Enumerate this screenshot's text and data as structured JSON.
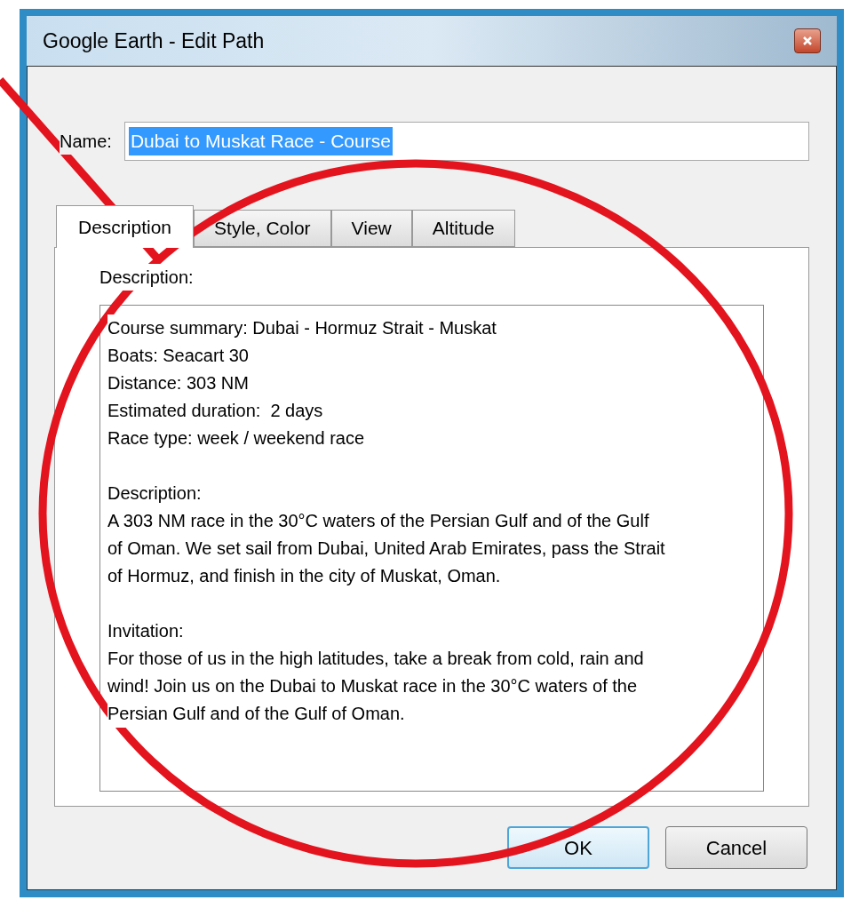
{
  "window": {
    "title": "Google Earth - Edit Path"
  },
  "name_field": {
    "label": "Name:",
    "value": "Dubai to Muskat Race - Course",
    "selected": true
  },
  "tabs": [
    {
      "label": "Description",
      "selected": true
    },
    {
      "label": "Style, Color",
      "selected": false
    },
    {
      "label": "View",
      "selected": false
    },
    {
      "label": "Altitude",
      "selected": false
    }
  ],
  "description": {
    "label": "Description:",
    "paragraphs": [
      [
        "Course summary: Dubai - Hormuz Strait - Muskat",
        "Boats: Seacart 30",
        "Distance: 303 NM",
        "Estimated duration:  2 days",
        "Race type: week / weekend race"
      ],
      [
        "Description:",
        "A 303 NM race in the 30°C waters of the Persian Gulf and of the Gulf",
        "of Oman. We set sail from Dubai, United Arab Emirates, pass the Strait",
        "of Hormuz, and finish in the city of Muskat, Oman."
      ],
      [
        "Invitation:",
        "For those of us in the high latitudes, take a break from cold, rain and",
        "wind! Join us on the Dubai to Muskat race in the 30°C waters of the",
        "Persian Gulf and of the Gulf of Oman."
      ]
    ]
  },
  "buttons": [
    {
      "label": "OK",
      "kind": "default"
    },
    {
      "label": "Cancel",
      "kind": "normal"
    }
  ]
}
